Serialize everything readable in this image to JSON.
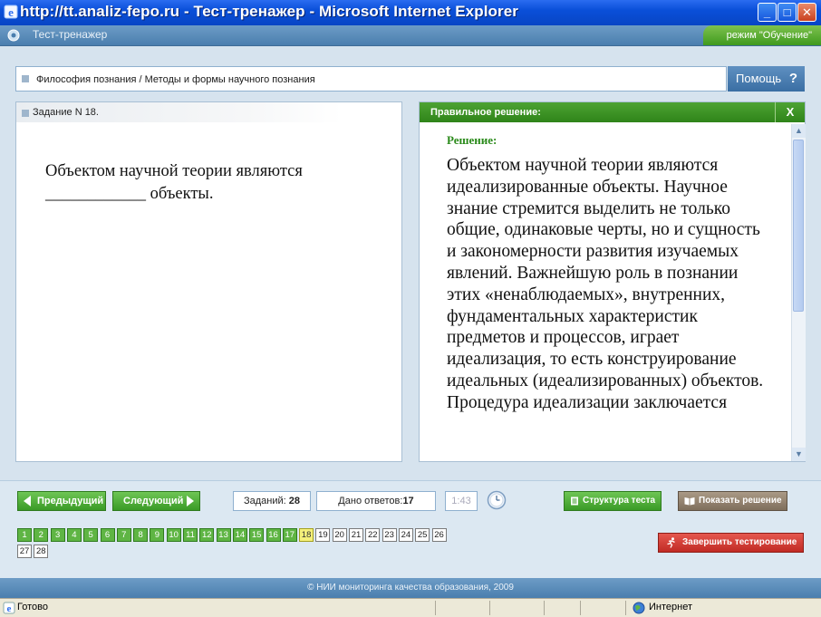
{
  "window": {
    "title": "http://tt.analiz-fepo.ru - Тест-тренажер - Microsoft Internet Explorer",
    "min": "_",
    "max": "□",
    "close": "✕"
  },
  "app": {
    "name": "Тест-тренажер",
    "mode": "режим \"Обучение\""
  },
  "breadcrumb": "Философия познания / Методы и формы научного познания",
  "help_label": "Помощь",
  "help_q": "?",
  "task": {
    "header": "Задание N 18.",
    "question": "Объектом научной теории являются ____________ объекты."
  },
  "solution": {
    "header": "Правильное решение:",
    "close": "X",
    "label": "Решение:",
    "text": "Объектом научной теории являются идеализированные объекты. Научное знание стремится выделить не только общие, одинаковые черты, но и сущность и закономерности развития изучаемых явлений. Важнейшую роль в познании этих «ненаблюдаемых», внутренних, фундаментальных характеристик предметов и процессов, играет идеализация, то есть конструирование идеальных (идеализированных) объектов. Процедура идеализации заключается"
  },
  "controls": {
    "prev": "Предыдущий",
    "next": "Следующий",
    "tasks_label": "Заданий:",
    "tasks_count": "28",
    "answered_label": "Дано ответов:",
    "answered_count": "17",
    "timer": "1:43",
    "structure": "Структура теста",
    "show_solution": "Показать решение",
    "finish": "Завершить тестирование"
  },
  "numbers": {
    "items": [
      "1",
      "2",
      "3",
      "4",
      "5",
      "6",
      "7",
      "8",
      "9",
      "10",
      "11",
      "12",
      "13",
      "14",
      "15",
      "16",
      "17",
      "18",
      "19",
      "20",
      "21",
      "22",
      "23",
      "24",
      "25",
      "26",
      "27",
      "28"
    ],
    "answered_through": 17,
    "current": 18
  },
  "footer": "© НИИ мониторинга качества образования, 2009",
  "status": {
    "left": "Готово",
    "zone": "Интернет"
  },
  "colors": {
    "titlebar": "#0a4fd9",
    "green_button": "#3a9a26",
    "current_number": "#f5f07a",
    "finish_button": "#c12b25"
  }
}
